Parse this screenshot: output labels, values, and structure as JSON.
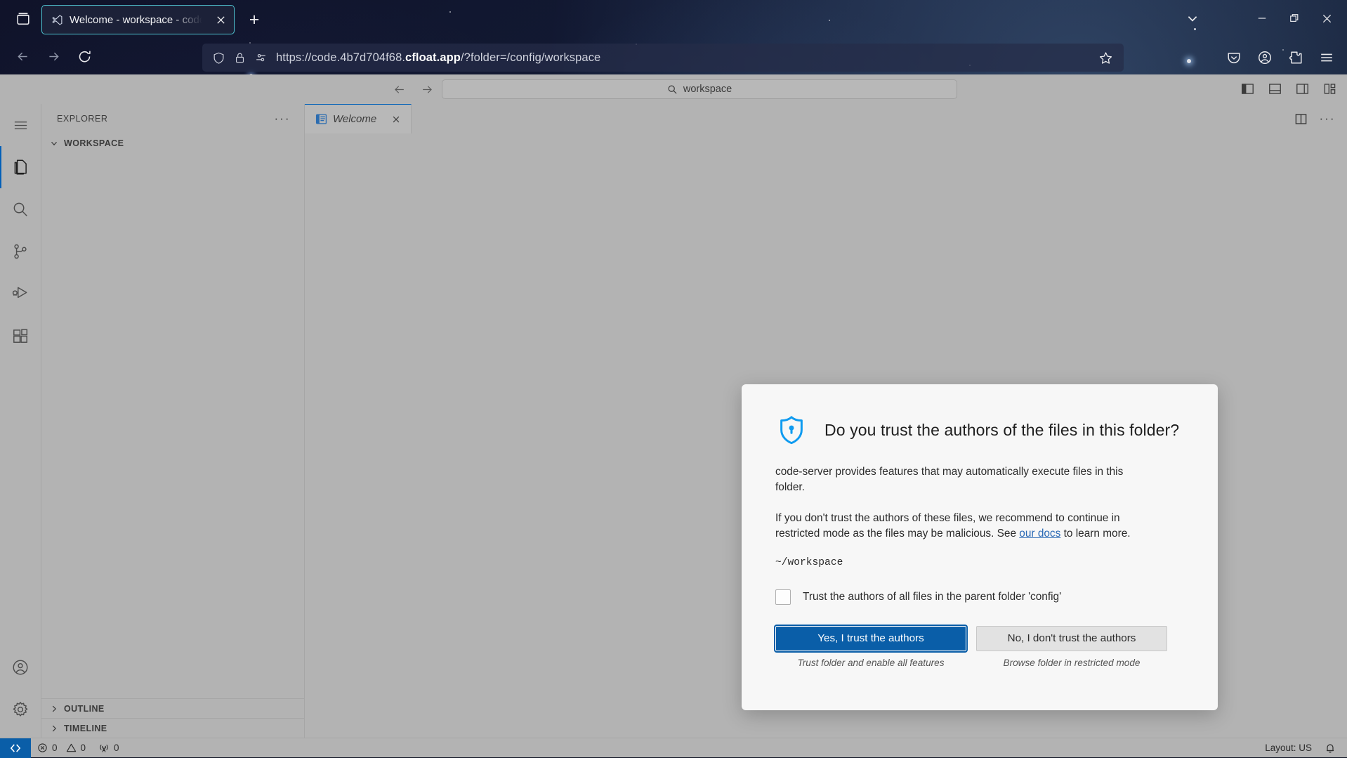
{
  "browser": {
    "tab": {
      "title": "Welcome - workspace - code-se",
      "favicon_icon": "vscode-favicon",
      "close_icon": "close-icon"
    },
    "new_tab_label": "+",
    "firefox_view_icon": "firefox-view-icon",
    "tabs_chevron_icon": "chevron-down-icon",
    "window_controls": {
      "minimize_icon": "minimize-icon",
      "maximize_icon": "maximize-icon",
      "close_icon": "close-icon"
    },
    "nav": {
      "back_icon": "back-arrow-icon",
      "forward_icon": "forward-arrow-icon",
      "reload_icon": "reload-icon"
    },
    "urlbar": {
      "shield_icon": "shield-icon",
      "lock_icon": "lock-icon",
      "permissions_icon": "permissions-icon",
      "url_prefix": "https://code.4b7d704f68.",
      "url_domain": "cfloat.app",
      "url_suffix": "/?folder=/config/workspace",
      "full_url": "https://code.4b7d704f68.cfloat.app/?folder=/config/workspace",
      "bookmark_icon": "star-icon"
    },
    "toolbar_right": [
      {
        "name": "pocket-icon"
      },
      {
        "name": "account-icon"
      },
      {
        "name": "extensions-icon"
      },
      {
        "name": "app-menu-icon"
      }
    ]
  },
  "vscode": {
    "titlebar": {
      "back_icon": "back-arrow-icon",
      "forward_icon": "forward-arrow-icon",
      "quick_input": {
        "search_icon": "search-icon",
        "value": "workspace"
      },
      "layout_icons": [
        {
          "name": "toggle-primary-sidebar-icon"
        },
        {
          "name": "toggle-panel-icon"
        },
        {
          "name": "toggle-secondary-sidebar-icon"
        },
        {
          "name": "customize-layout-icon"
        }
      ]
    },
    "activitybar": {
      "menu_icon": "hamburger-menu-icon",
      "items": [
        {
          "name": "explorer",
          "icon": "files-icon",
          "active": true
        },
        {
          "name": "search",
          "icon": "search-icon",
          "active": false
        },
        {
          "name": "source-control",
          "icon": "source-control-icon",
          "active": false
        },
        {
          "name": "run-and-debug",
          "icon": "run-debug-icon",
          "active": false
        },
        {
          "name": "extensions",
          "icon": "extensions-icon",
          "active": false
        }
      ],
      "bottom_items": [
        {
          "name": "accounts",
          "icon": "account-icon"
        },
        {
          "name": "manage",
          "icon": "gear-icon"
        }
      ]
    },
    "sidebar": {
      "title": "EXPLORER",
      "more_actions_label": "···",
      "sections": [
        {
          "label": "WORKSPACE",
          "expanded": true
        },
        {
          "label": "OUTLINE",
          "expanded": false
        },
        {
          "label": "TIMELINE",
          "expanded": false
        }
      ]
    },
    "editor": {
      "tabs": [
        {
          "label": "Welcome",
          "icon": "welcome-page-icon",
          "close_icon": "close-icon",
          "active": true,
          "preview": true
        }
      ],
      "actions": [
        {
          "name": "split-editor-icon"
        },
        {
          "name": "more-actions-icon",
          "label": "···"
        }
      ]
    },
    "dialog": {
      "icon": "shield-lock-icon",
      "title": "Do you trust the authors of the files in this folder?",
      "paragraph1": "code-server provides features that may automatically execute files in this folder.",
      "paragraph2_before": "If you don't trust the authors of these files, we recommend to continue in restricted mode as the files may be malicious. See ",
      "paragraph2_link": "our docs",
      "paragraph2_after": " to learn more.",
      "path": "~/workspace",
      "checkbox_label": "Trust the authors of all files in the parent folder 'config'",
      "checkbox_checked": false,
      "primary_button": "Yes, I trust the authors",
      "primary_caption": "Trust folder and enable all features",
      "secondary_button": "No, I don't trust the authors",
      "secondary_caption": "Browse folder in restricted mode"
    },
    "statusbar": {
      "remote_icon": "remote-host-icon",
      "problems": {
        "error_icon": "error-icon",
        "errors": "0",
        "warning_icon": "warning-icon",
        "warnings": "0"
      },
      "ports": {
        "icon": "ports-icon",
        "count": "0"
      },
      "keyboard_layout": "Layout: US",
      "notifications_icon": "bell-icon"
    }
  },
  "colors": {
    "accent": "#005fb8",
    "primary_button": "#0a5ea8",
    "link": "#2b6ab5",
    "shield": "#0f9bf0",
    "editor_bg": "#b3b3b3",
    "dialog_bg": "#f7f7f7",
    "tab_border": "#4fc3d0"
  }
}
